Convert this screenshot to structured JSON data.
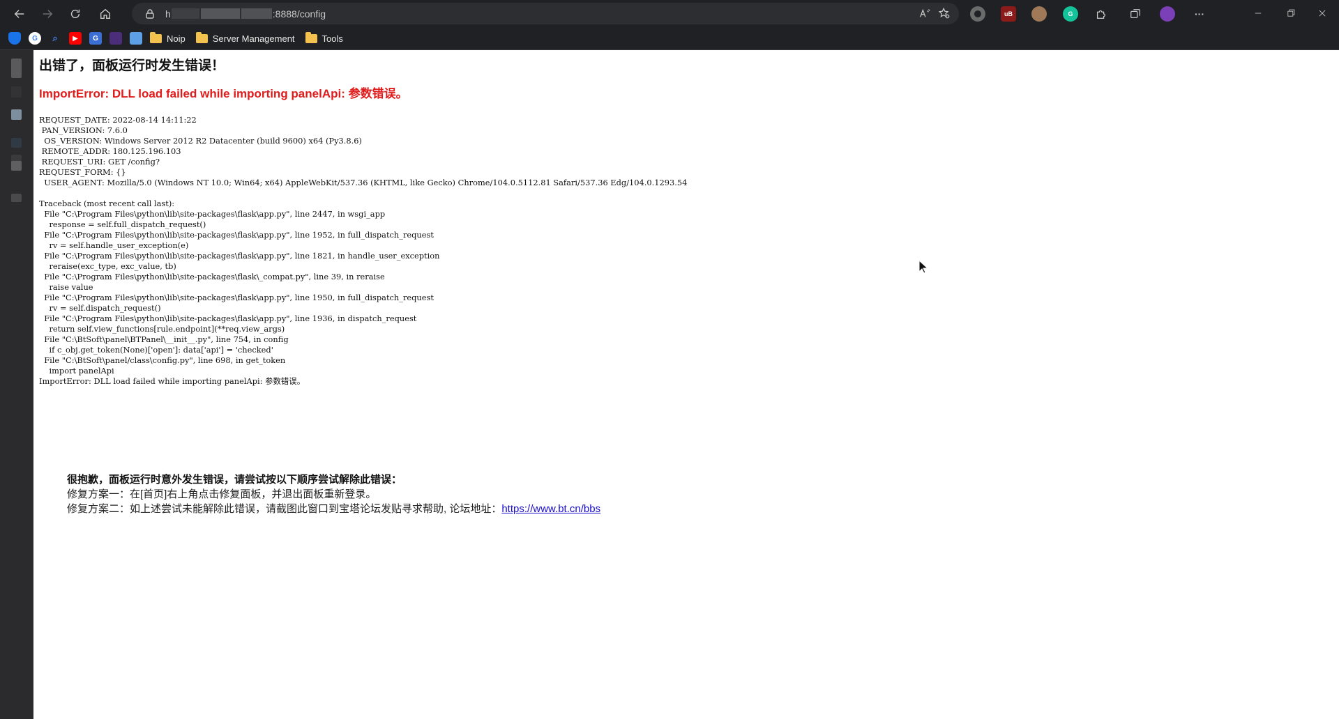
{
  "browser": {
    "url_prefix": "h",
    "url_suffix": ":8888/config",
    "bookmarks": [
      {
        "name": "Noip"
      },
      {
        "name": "Server Management"
      },
      {
        "name": "Tools"
      }
    ]
  },
  "page": {
    "title": "出错了，面板运行时发生错误！",
    "error_headline": "ImportError: DLL load failed while importing panelApi: 参数错误。",
    "request_info": [
      "REQUEST_DATE: 2022-08-14 14:11:22",
      " PAN_VERSION: 7.6.0",
      "  OS_VERSION: Windows Server 2012 R2 Datacenter (build 9600) x64 (Py3.8.6)",
      " REMOTE_ADDR: 180.125.196.103",
      " REQUEST_URI: GET /config?",
      "REQUEST_FORM: {}",
      "  USER_AGENT: Mozilla/5.0 (Windows NT 10.0; Win64; x64) AppleWebKit/537.36 (KHTML, like Gecko) Chrome/104.0.5112.81 Safari/537.36 Edg/104.0.1293.54"
    ],
    "traceback": [
      "Traceback (most recent call last):",
      "  File \"C:\\Program Files\\python\\lib\\site-packages\\flask\\app.py\", line 2447, in wsgi_app",
      "    response = self.full_dispatch_request()",
      "  File \"C:\\Program Files\\python\\lib\\site-packages\\flask\\app.py\", line 1952, in full_dispatch_request",
      "    rv = self.handle_user_exception(e)",
      "  File \"C:\\Program Files\\python\\lib\\site-packages\\flask\\app.py\", line 1821, in handle_user_exception",
      "    reraise(exc_type, exc_value, tb)",
      "  File \"C:\\Program Files\\python\\lib\\site-packages\\flask\\_compat.py\", line 39, in reraise",
      "    raise value",
      "  File \"C:\\Program Files\\python\\lib\\site-packages\\flask\\app.py\", line 1950, in full_dispatch_request",
      "    rv = self.dispatch_request()",
      "  File \"C:\\Program Files\\python\\lib\\site-packages\\flask\\app.py\", line 1936, in dispatch_request",
      "    return self.view_functions[rule.endpoint](**req.view_args)",
      "  File \"C:\\BtSoft\\panel\\BTPanel\\__init__.py\", line 754, in config",
      "    if c_obj.get_token(None)['open']: data['api'] = 'checked'",
      "  File \"C:\\BtSoft\\panel/class\\config.py\", line 698, in get_token",
      "    import panelApi",
      "ImportError: DLL load failed while importing panelApi: 参数错误。"
    ],
    "help": {
      "heading": "很抱歉，面板运行时意外发生错误，请尝试按以下顺序尝试解除此错误：",
      "fix1": "修复方案一：在[首页]右上角点击修复面板，并退出面板重新登录。",
      "fix2_prefix": "修复方案二：如上述尝试未能解除此错误，请截图此窗口到宝塔论坛发贴寻求帮助, 论坛地址：",
      "forum_link": "https://www.bt.cn/bbs"
    }
  },
  "colors": {
    "chrome_bg": "#202124",
    "error_red": "#e01b1b",
    "link_blue": "#1a0dcc"
  }
}
